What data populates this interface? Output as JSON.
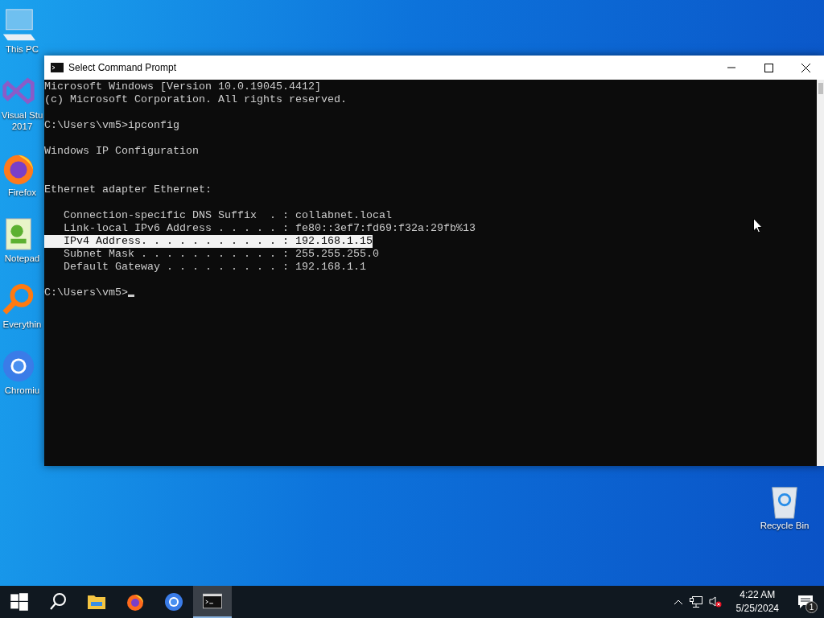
{
  "desktop_icons": [
    {
      "kind": "pc",
      "label": "This PC"
    },
    {
      "kind": "vs",
      "label": "Visual Stu 2017"
    },
    {
      "kind": "firefox",
      "label": "Firefox"
    },
    {
      "kind": "notepad",
      "label": "Notepad"
    },
    {
      "kind": "everything",
      "label": "Everythin"
    },
    {
      "kind": "chromium",
      "label": "Chromiu"
    }
  ],
  "recycle_bin": {
    "label": "Recycle Bin"
  },
  "window": {
    "title": "Select Command Prompt",
    "console": {
      "lines": [
        {
          "kind": "text",
          "text": "Microsoft Windows [Version 10.0.19045.4412]",
          "selected": false
        },
        {
          "kind": "text",
          "text": "(c) Microsoft Corporation. All rights reserved.",
          "selected": false
        },
        {
          "kind": "blank"
        },
        {
          "kind": "text",
          "text": "C:\\Users\\vm5>ipconfig",
          "selected": false
        },
        {
          "kind": "blank"
        },
        {
          "kind": "text",
          "text": "Windows IP Configuration",
          "selected": false
        },
        {
          "kind": "blank"
        },
        {
          "kind": "blank"
        },
        {
          "kind": "text",
          "text": "Ethernet adapter Ethernet:",
          "selected": false
        },
        {
          "kind": "blank"
        },
        {
          "kind": "text",
          "text": "   Connection-specific DNS Suffix  . : collabnet.local",
          "selected": false
        },
        {
          "kind": "text",
          "text": "   Link-local IPv6 Address . . . . . : fe80::3ef7:fd69:f32a:29fb%13",
          "selected": false
        },
        {
          "kind": "text",
          "text": "   IPv4 Address. . . . . . . . . . . : 192.168.1.15",
          "selected": true
        },
        {
          "kind": "text",
          "text": "   Subnet Mask . . . . . . . . . . . : 255.255.255.0",
          "selected": false
        },
        {
          "kind": "text",
          "text": "   Default Gateway . . . . . . . . . : 192.168.1.1",
          "selected": false
        },
        {
          "kind": "blank"
        }
      ],
      "prompt": {
        "text": "C:\\Users\\vm5>",
        "cursor": true
      }
    }
  },
  "taskbar": {
    "apps": [
      {
        "kind": "start",
        "selected": false
      },
      {
        "kind": "search",
        "selected": false
      },
      {
        "kind": "explorer",
        "selected": false
      },
      {
        "kind": "firefox",
        "selected": false
      },
      {
        "kind": "chromium",
        "selected": false
      },
      {
        "kind": "cmd",
        "selected": true
      }
    ],
    "tray": {
      "time": "4:22 AM",
      "date": "5/25/2024",
      "notifications": "1"
    }
  }
}
